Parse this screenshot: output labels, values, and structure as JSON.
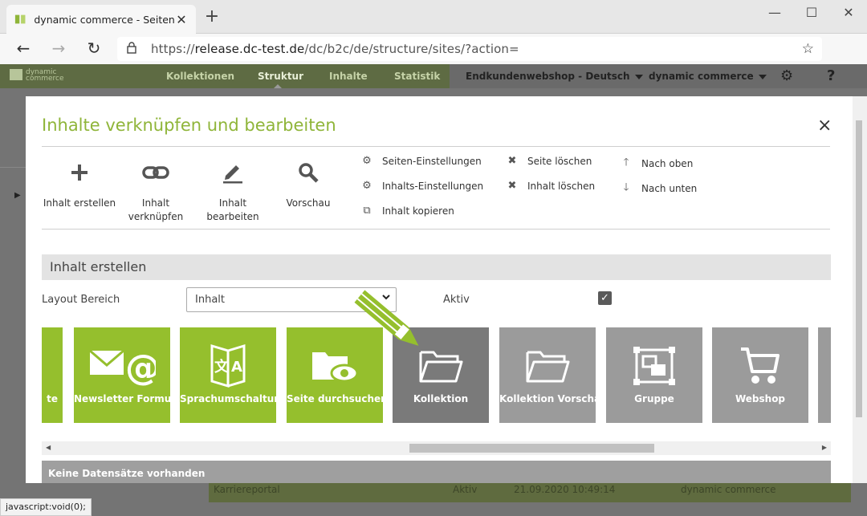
{
  "browser": {
    "tab_title": "dynamic commerce - Seiten",
    "url_prefix": "https://",
    "url_host": "release.dc-test.de",
    "url_path": "/dc/b2c/de/structure/sites/?action=",
    "status_text": "javascript:void(0);"
  },
  "app": {
    "logo_line1": "dynamic",
    "logo_line2": "commerce",
    "nav": [
      "Kollektionen",
      "Struktur",
      "Inhalte",
      "Statistik"
    ],
    "shop_select": "Endkundenwebshop - Deutsch",
    "company_select": "dynamic commerce",
    "help": "?"
  },
  "background_row": {
    "name": "Karriereportal",
    "status": "Aktiv",
    "date": "21.09.2020 10:49:14",
    "owner": "dynamic commerce"
  },
  "modal": {
    "title": "Inhalte verknüpfen und bearbeiten",
    "close": "×",
    "tools": [
      {
        "label": "Inhalt erstellen",
        "icon": "plus-icon"
      },
      {
        "label": "Inhalt verknüpfen",
        "icon": "link-icon"
      },
      {
        "label": "Inhalt bearbeiten",
        "icon": "pencil-icon"
      },
      {
        "label": "Vorschau",
        "icon": "search-icon"
      }
    ],
    "actions": {
      "seiten_einstellungen": "Seiten-Einstellungen",
      "inhalts_einstellungen": "Inhalts-Einstellungen",
      "inhalt_kopieren": "Inhalt kopieren",
      "seite_loeschen": "Seite löschen",
      "inhalt_loeschen": "Inhalt löschen",
      "nach_oben": "Nach oben",
      "nach_unten": "Nach unten"
    },
    "section_title": "Inhalt erstellen",
    "layout_label": "Layout Bereich",
    "layout_value": "Inhalt",
    "aktiv_label": "Aktiv",
    "aktiv_checked": true,
    "tiles": [
      {
        "label": "te",
        "color": "#95bf2d"
      },
      {
        "label": "Newsletter Formular",
        "color": "#95bf2d",
        "icon": "newsletter-icon"
      },
      {
        "label": "Sprachumschaltung",
        "color": "#95bf2d",
        "icon": "translate-icon"
      },
      {
        "label": "Seite durchsuchen",
        "color": "#95bf2d",
        "icon": "folder-eye-icon"
      },
      {
        "label": "Kollektion",
        "color": "#7a7a7a",
        "icon": "folder-icon"
      },
      {
        "label": "Kollektion Vorschau",
        "color": "#9b9b9b",
        "icon": "folder-icon"
      },
      {
        "label": "Gruppe",
        "color": "#9b9b9b",
        "icon": "group-icon"
      },
      {
        "label": "Webshop",
        "color": "#9b9b9b",
        "icon": "cart-icon"
      }
    ],
    "empty_message": "Keine Datensätze vorhanden"
  }
}
